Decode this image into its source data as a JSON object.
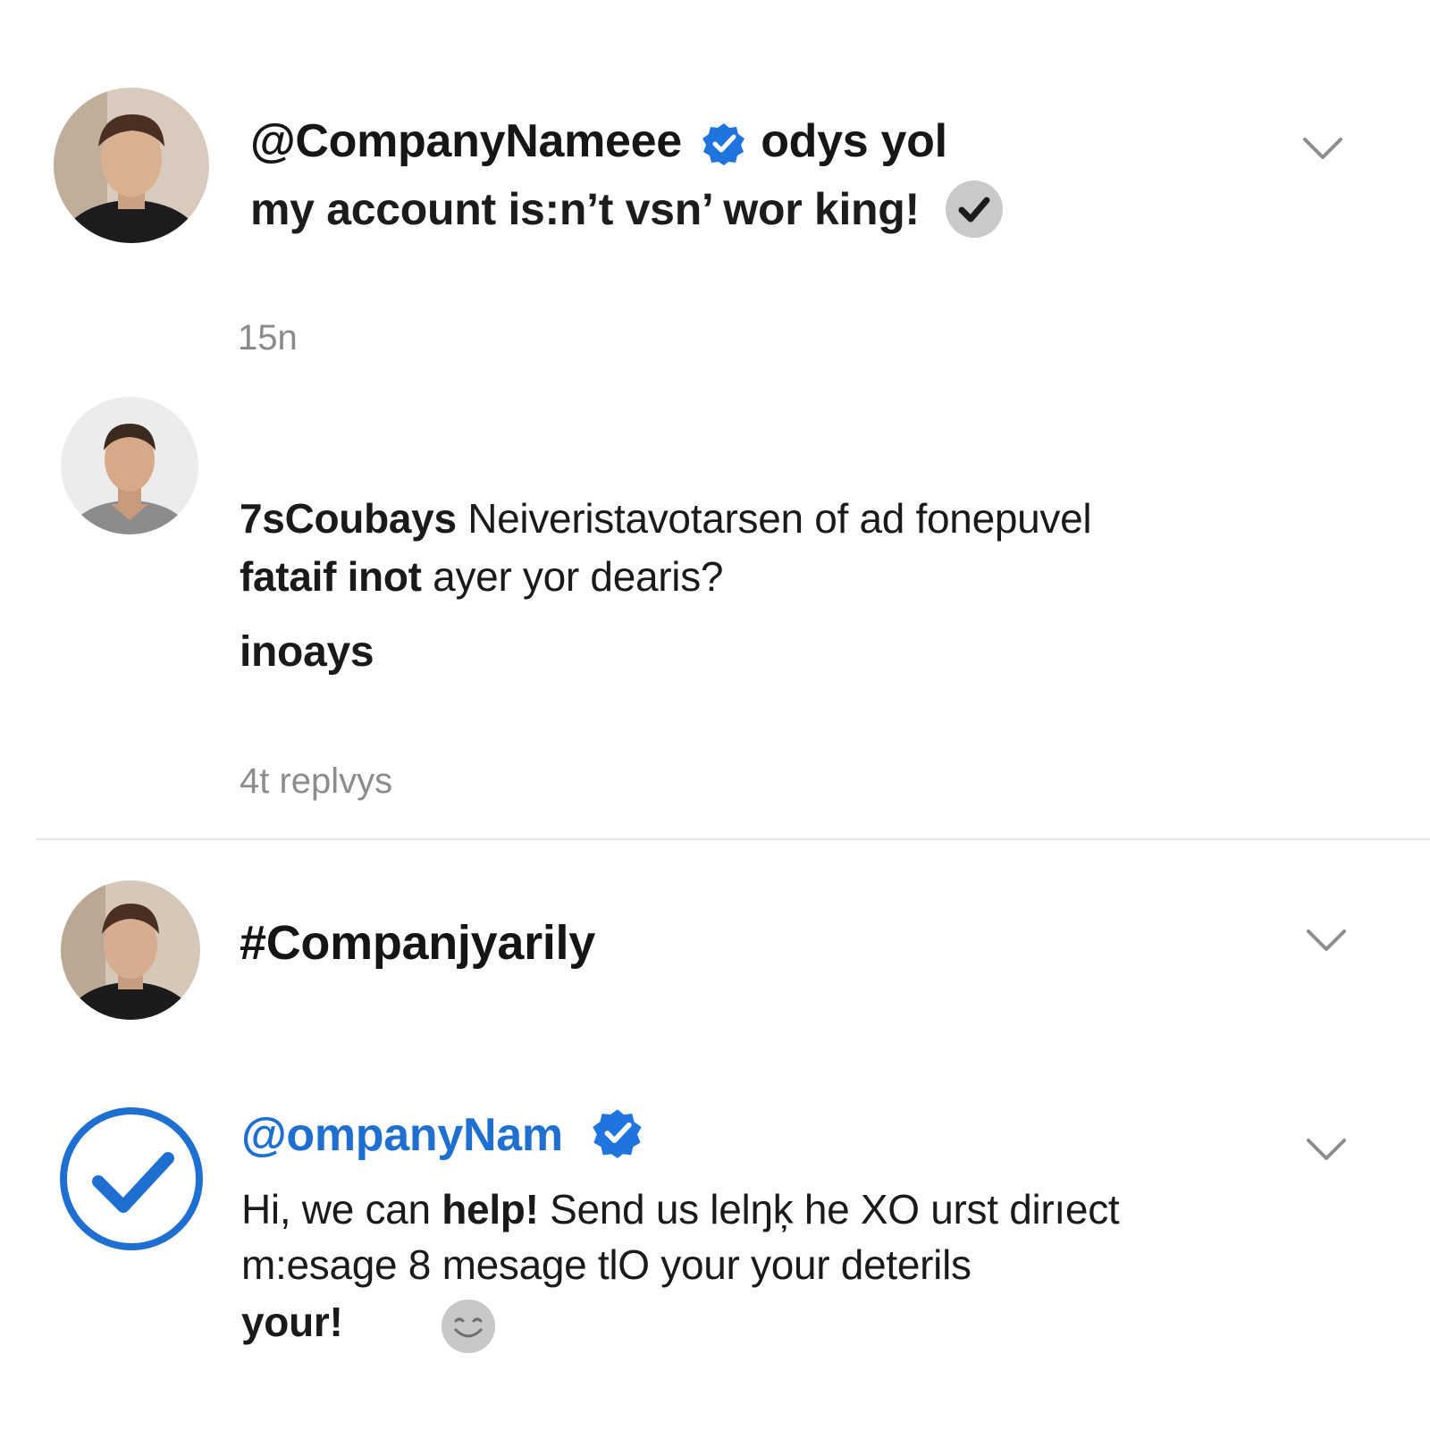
{
  "post1": {
    "handle": "@CompanyNameee",
    "handle_suffix": "odys yol",
    "text": "my account is:n’t vsn’ wor king!",
    "time": "15n"
  },
  "post2": {
    "text_line1_bold": "7sCoubays",
    "text_line1_rest": "Neiveristavotarsen of ad fonepuvel",
    "text_line2_bold": "fataif inot",
    "text_line2_rest": "ayer yor dearis?",
    "text_line3": "inoays",
    "replies": "4t replvys"
  },
  "post3": {
    "hashtag": "#Companjyarily"
  },
  "reply": {
    "handle": "@ompanyNam",
    "line1_a": "Hi, we can ",
    "line1_b": "help!",
    "line1_c": " Send us lelŋķ he XO urst dirıect",
    "line2": "m:esage 8 mesage tlO your your deterils",
    "line3": "your!"
  },
  "colors": {
    "brand_blue": "#1f6fd1",
    "verified_blue": "#1f74e0",
    "muted_gray": "#8a8a8a",
    "badge_gray": "#c9c9c9"
  },
  "icons": {
    "verified": "verified-badge-icon",
    "check_gray": "check-circle-icon",
    "chevron": "chevron-down-icon",
    "emoji": "smiley-emoji-icon",
    "brand_avatar": "check-logo-icon"
  }
}
